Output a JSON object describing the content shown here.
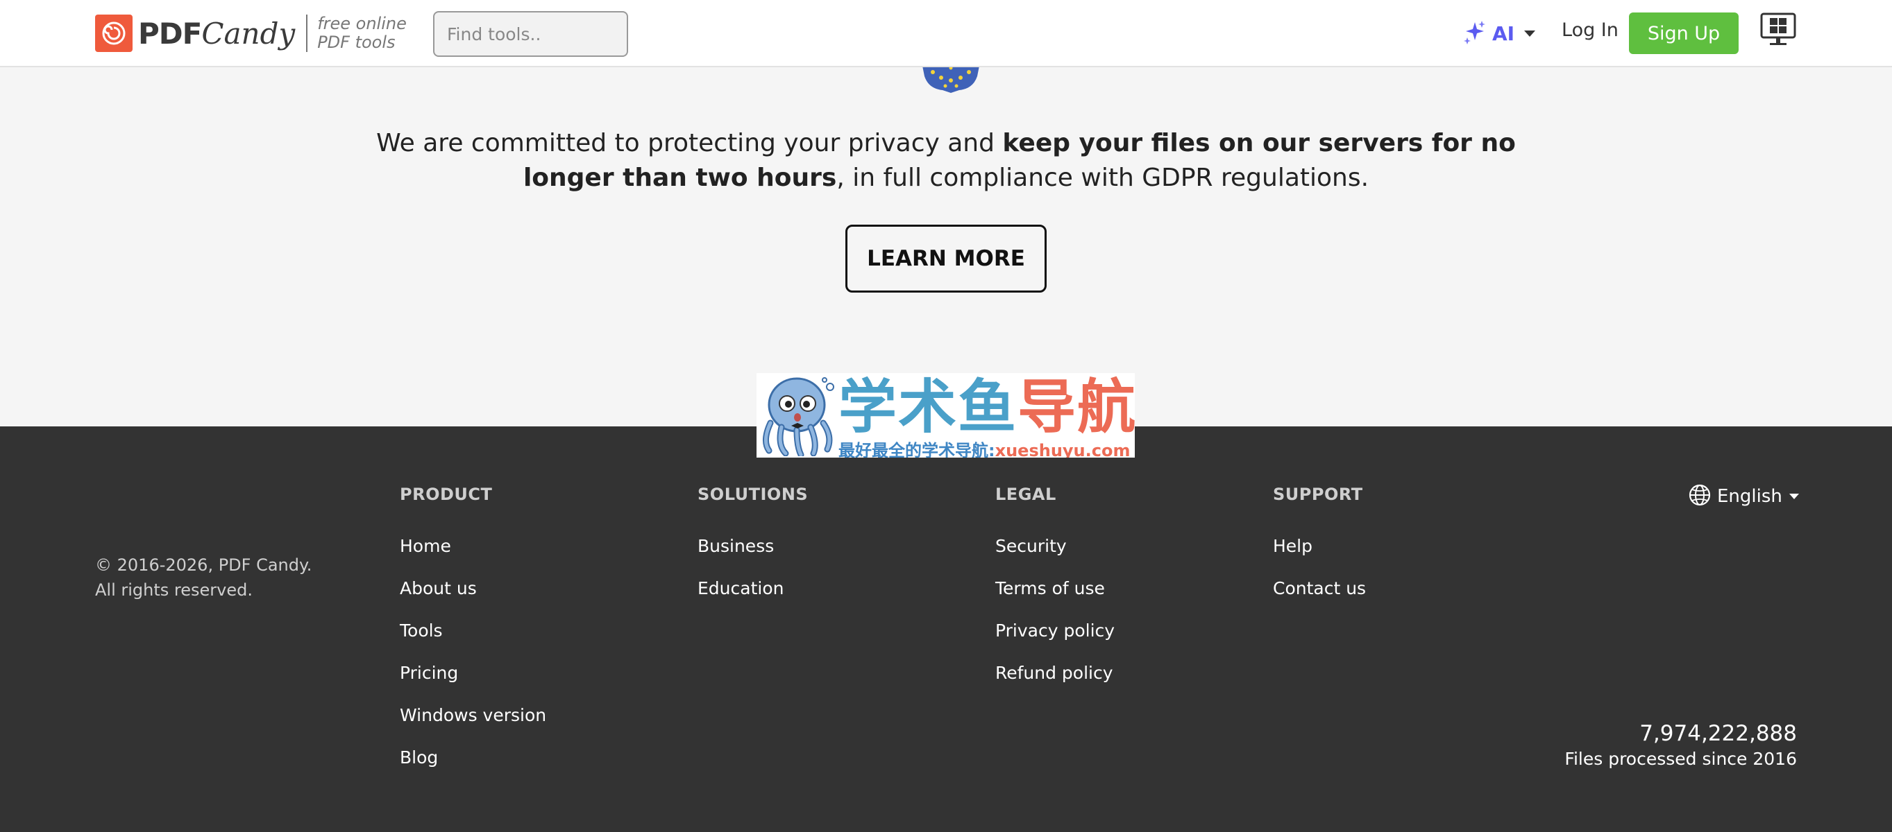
{
  "header": {
    "logo_brand_pdf": "PDF",
    "logo_brand_candy": "Candy",
    "logo_tagline_line1": "free online",
    "logo_tagline_line2": "PDF tools",
    "search_placeholder": "Find tools..",
    "ai_label": "AI",
    "login_label": "Log In",
    "signup_label": "Sign Up"
  },
  "privacy": {
    "text_before": "We are committed to protecting your privacy and ",
    "text_bold": "keep your files on our servers for no longer than two hours",
    "text_after": ", in full compliance with GDPR regulations.",
    "learn_more_label": "LEARN MORE"
  },
  "watermark": {
    "title_part1": "学术鱼",
    "title_part2": "导航",
    "subtitle_part1": "最好最全的学术导航:",
    "subtitle_part2": "xueshuyu.com"
  },
  "footer": {
    "copyright_line1": "© 2016-2026, PDF Candy.",
    "copyright_line2": "All rights reserved.",
    "columns": [
      {
        "heading": "PRODUCT",
        "links": [
          "Home",
          "About us",
          "Tools",
          "Pricing",
          "Windows version",
          "Blog"
        ]
      },
      {
        "heading": "SOLUTIONS",
        "links": [
          "Business",
          "Education"
        ]
      },
      {
        "heading": "LEGAL",
        "links": [
          "Security",
          "Terms of use",
          "Privacy policy",
          "Refund policy"
        ]
      },
      {
        "heading": "SUPPORT",
        "links": [
          "Help",
          "Contact us"
        ]
      }
    ],
    "language_label": "English",
    "files_count": "7,974,222,888",
    "files_label": "Files processed since 2016"
  },
  "colors": {
    "brand_red": "#ef5a3c",
    "signup_green": "#5fbf3f",
    "ai_purple": "#5b5bf0",
    "footer_bg": "#333333",
    "page_bg": "#f5f5f5"
  },
  "icons": [
    "candy-logo-icon",
    "ai-sparkle-icon",
    "chevron-down-icon",
    "windows-monitor-icon",
    "eu-stars-icon",
    "globe-icon",
    "octopus-mascot-icon"
  ]
}
